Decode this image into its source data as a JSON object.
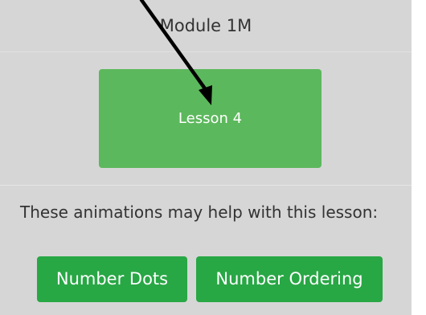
{
  "header": {
    "title": "Module 1M"
  },
  "lesson": {
    "label": "Lesson 4"
  },
  "animations": {
    "intro": "These animations may help with this lesson:",
    "buttons": [
      {
        "label": "Number Dots"
      },
      {
        "label": "Number Ordering"
      }
    ]
  },
  "colors": {
    "lesson_button": "#5cb85c",
    "animation_button": "#28a745",
    "panel": "#d6d6d6",
    "arrow": "#000000"
  },
  "annotation": {
    "arrow": "arrow-pointing-to-lesson-button"
  }
}
